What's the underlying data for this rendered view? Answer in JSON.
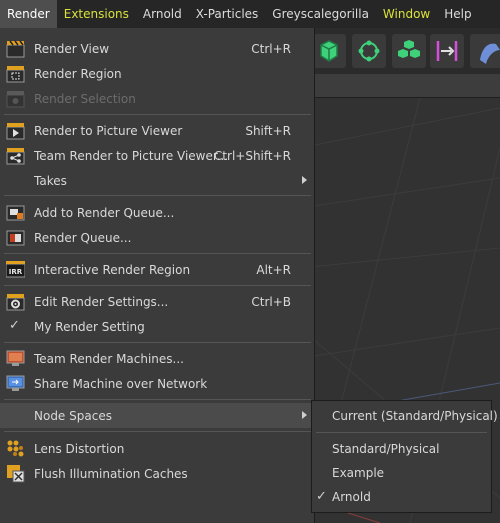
{
  "menubar": {
    "items": [
      {
        "label": "Render",
        "active": true
      },
      {
        "label": "Extensions",
        "color": "#d8e23a"
      },
      {
        "label": "Arnold"
      },
      {
        "label": "X-Particles"
      },
      {
        "label": "Greyscalegorilla"
      },
      {
        "label": "Window",
        "color": "#d8e23a"
      },
      {
        "label": "Help"
      }
    ]
  },
  "menu": {
    "items": [
      {
        "label": "Render View",
        "shortcut": "Ctrl+R",
        "icon": "render-view-icon"
      },
      {
        "label": "Render Region",
        "shortcut": "",
        "icon": "render-region-icon"
      },
      {
        "label": "Render Selection",
        "shortcut": "",
        "icon": "render-selection-icon",
        "disabled": true
      },
      {
        "label": "Render to Picture Viewer",
        "shortcut": "Shift+R",
        "icon": "picture-viewer-icon"
      },
      {
        "label": "Team Render to Picture Viewer...",
        "shortcut": "Ctrl+Shift+R",
        "icon": "team-render-icon"
      },
      {
        "label": "Takes",
        "shortcut": "",
        "submenu": true
      },
      {
        "label": "Add to Render Queue...",
        "shortcut": "",
        "icon": "add-render-queue-icon"
      },
      {
        "label": "Render Queue...",
        "shortcut": "",
        "icon": "render-queue-icon"
      },
      {
        "label": "Interactive Render Region",
        "shortcut": "Alt+R",
        "icon": "irr-icon",
        "icon_text": "IRR"
      },
      {
        "label": "Edit Render Settings...",
        "shortcut": "Ctrl+B",
        "icon": "render-settings-icon"
      },
      {
        "label": "My Render Setting",
        "shortcut": "",
        "checked": true
      },
      {
        "label": "Team Render Machines...",
        "shortcut": "",
        "icon": "team-render-machines-icon"
      },
      {
        "label": "Share Machine over Network",
        "shortcut": "",
        "icon": "share-machine-icon"
      },
      {
        "label": "Node Spaces",
        "shortcut": "",
        "submenu": true,
        "highlighted": true
      },
      {
        "label": "Lens Distortion",
        "shortcut": "",
        "icon": "lens-distortion-icon"
      },
      {
        "label": "Flush Illumination Caches",
        "shortcut": "",
        "icon": "flush-caches-icon"
      }
    ]
  },
  "submenu": {
    "items": [
      {
        "label": "Current (Standard/Physical)"
      },
      {
        "label": "Standard/Physical"
      },
      {
        "label": "Example"
      },
      {
        "label": "Arnold",
        "checked": true
      }
    ]
  },
  "colors": {
    "menubar_bg": "#262626",
    "menu_bg": "#3b3b3b",
    "highlight_bg": "#4b4b4b",
    "accent_yellow": "#d8e23a",
    "toolbar_green": "#3fd07a",
    "toolbar_magenta": "#d64fd8"
  }
}
